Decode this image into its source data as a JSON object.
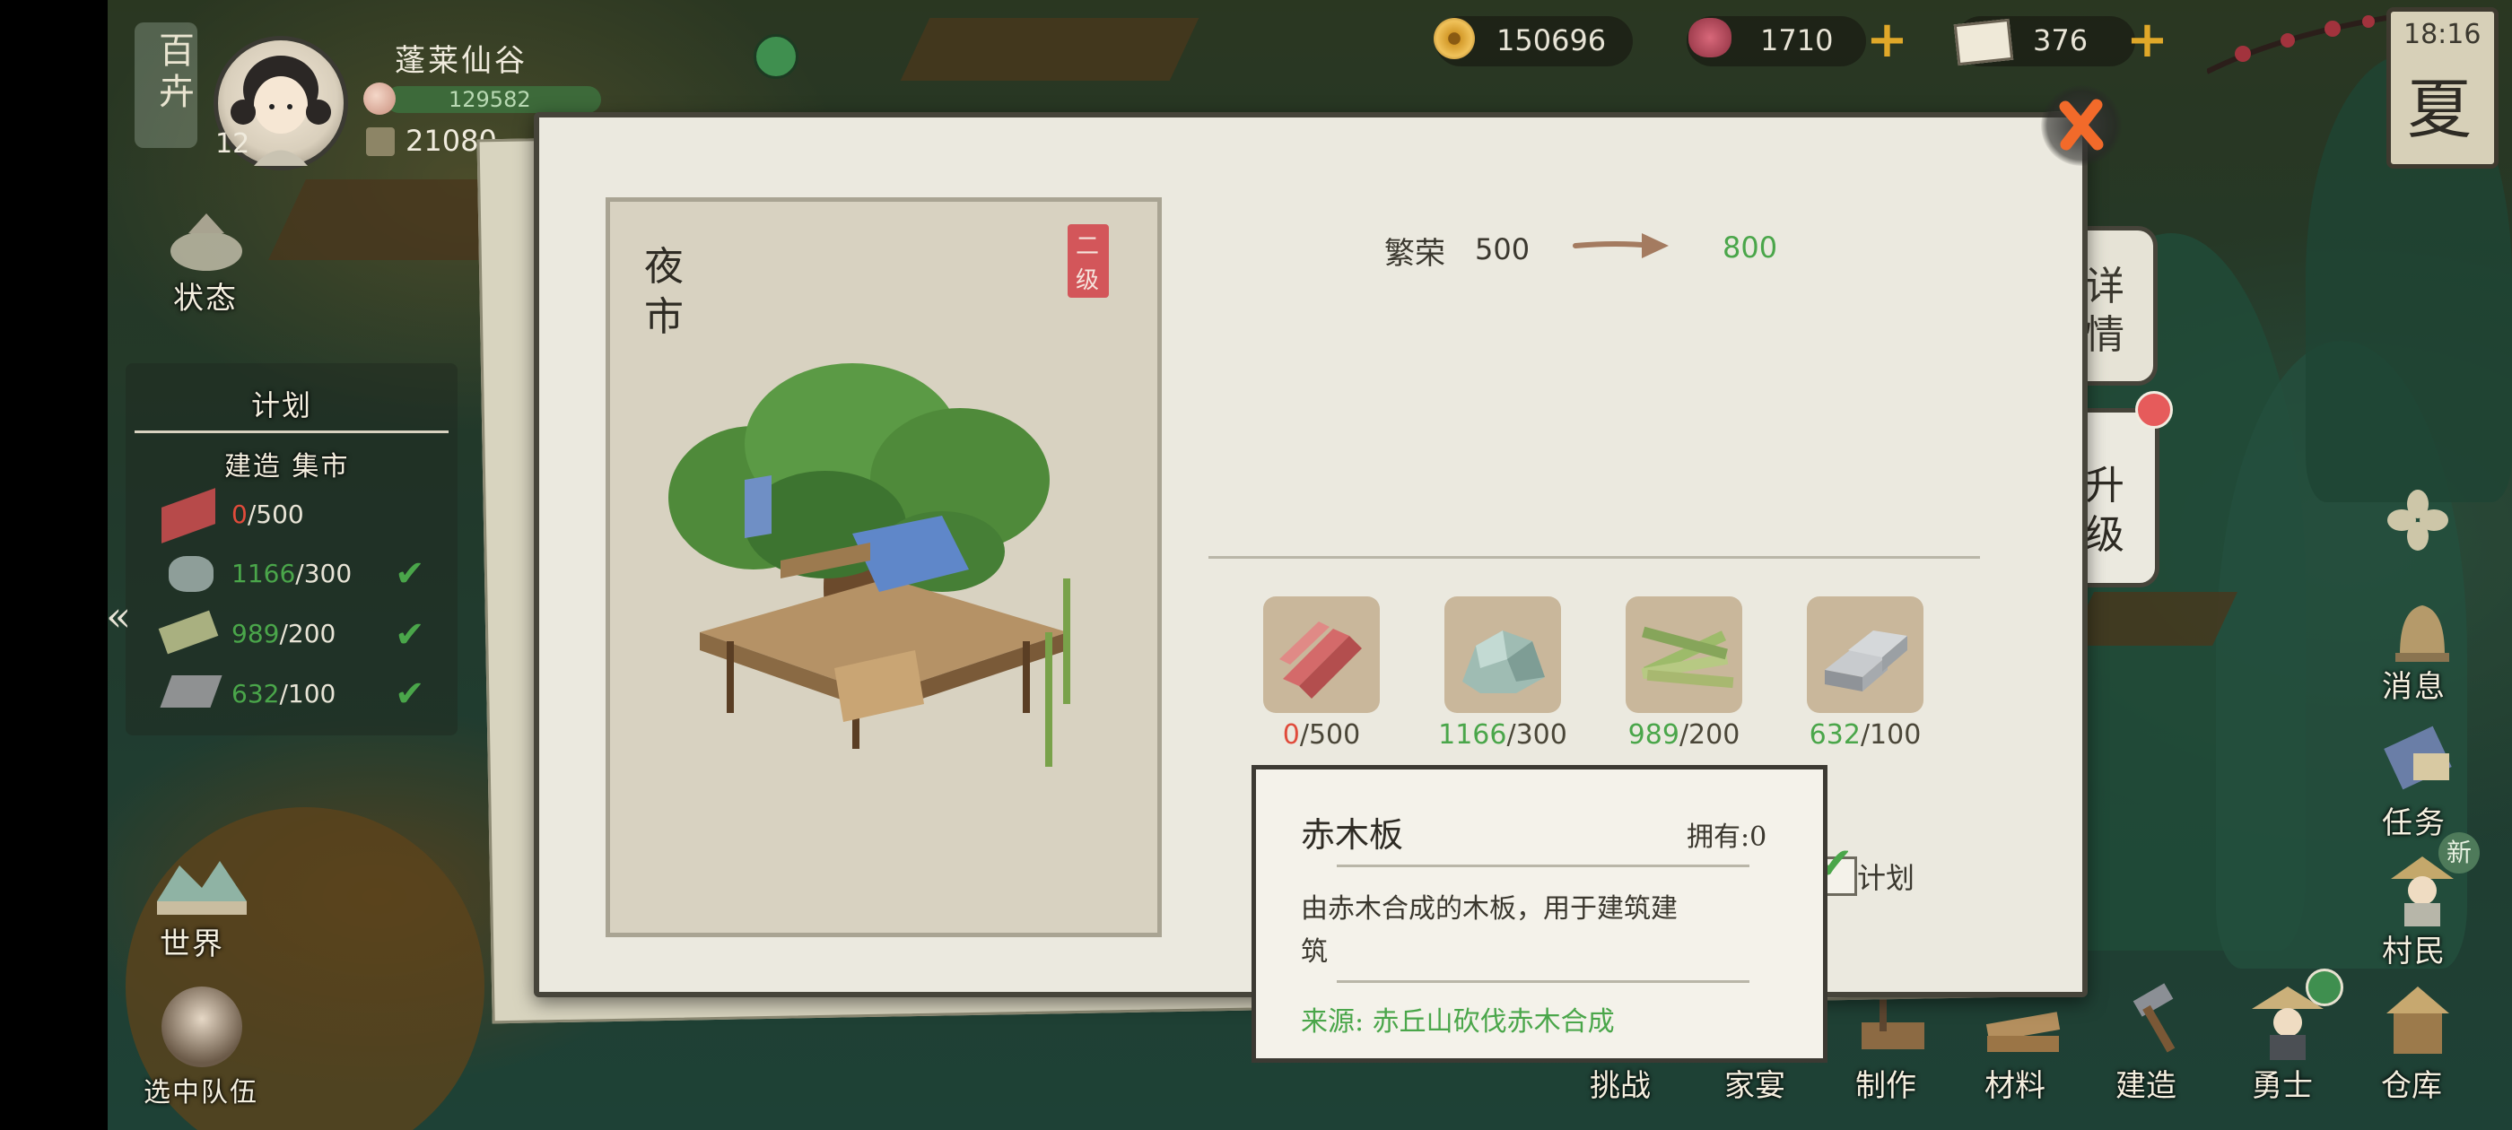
{
  "season_badge": "百卉",
  "player": {
    "name": "蓬莱仙谷",
    "level": "12",
    "exp_value": "129582",
    "storage_value": "21080"
  },
  "resources": {
    "coins": "150696",
    "gems": "1710",
    "tickets": "376"
  },
  "clock": {
    "time": "18:16",
    "season": "夏"
  },
  "left_menu": {
    "status": "状态",
    "world": "世界",
    "team": "选中队伍"
  },
  "plan_panel": {
    "title": "计划",
    "subtitle": "建造 集市",
    "items": [
      {
        "have": "0",
        "need": "/500"
      },
      {
        "have": "1166",
        "need": "/300"
      },
      {
        "have": "989",
        "need": "/200"
      },
      {
        "have": "632",
        "need": "/100"
      }
    ]
  },
  "right_menu": {
    "message": "消息",
    "tasks": "任务",
    "new_badge": "新",
    "villagers": "村民",
    "warriors": "勇士",
    "warehouse": "仓库"
  },
  "bottom_menu": {
    "challenge": "挑战",
    "feast": "家宴",
    "craft": "制作",
    "materials": "材料",
    "build": "建造"
  },
  "dialog": {
    "building_name_line1": "夜",
    "building_name_line2": "市",
    "level_line1": "二",
    "level_line2": "级",
    "prosperity_label": "繁荣",
    "prosperity_from": "500",
    "prosperity_to": "800",
    "tab_details_1": "详",
    "tab_details_2": "情",
    "tab_upgrade_1": "升",
    "tab_upgrade_2": "级",
    "plan_checkbox_label": "计划",
    "materials": [
      {
        "icon": "red-plank-icon",
        "have": "0",
        "need": "/500"
      },
      {
        "icon": "stone-icon",
        "have": "1166",
        "need": "/300"
      },
      {
        "icon": "bamboo-icon",
        "have": "989",
        "need": "/200"
      },
      {
        "icon": "iron-ingot-icon",
        "have": "632",
        "need": "/100"
      }
    ]
  },
  "tooltip": {
    "title": "赤木板",
    "owned": "拥有:0",
    "desc_line1": "由赤木合成的木板，用于建筑建",
    "desc_line2": "筑",
    "source": "来源: 赤丘山砍伐赤木合成"
  },
  "colors": {
    "accent_green": "#4aa64a",
    "accent_red": "#e04b3b",
    "close_orange": "#f26a2a",
    "plus_gold": "#e0a829"
  }
}
